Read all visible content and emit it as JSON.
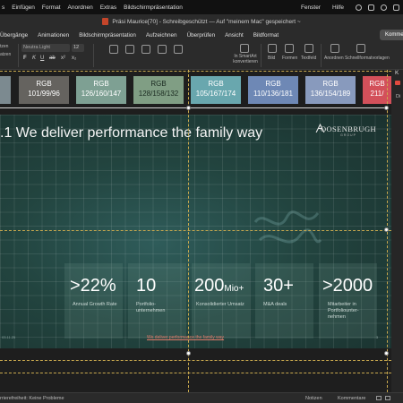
{
  "menubar": {
    "items": [
      "s",
      "Einfügen",
      "Format",
      "Anordnen",
      "Extras",
      "Bildschirmpräsentation"
    ],
    "right_items": [
      "Fenster",
      "Hilfe"
    ]
  },
  "titlebar": {
    "text": "Präsi Maurice[70] - Schreibgeschützt — Auf \"meinem Mac\" gespeichert ~"
  },
  "ribbon": {
    "tabs": [
      "Übergänge",
      "Animationen",
      "Bildschirmpräsentation",
      "Aufzeichnen",
      "Überprüfen",
      "Ansicht",
      "Bildformat"
    ],
    "comment_button": "Komme",
    "font_name": "Neutra Light",
    "font_size": "12",
    "left_partial": "tzen",
    "left_partial2": "atzen",
    "smartart_label": "In SmartArt konvertieren",
    "tools": [
      "Bild",
      "Formen",
      "Textfeld",
      "Anordnen",
      "Schnellformatvorlagen"
    ],
    "bold": "F",
    "italic": "K",
    "underline": "U",
    "strike": "ab",
    "superscript": "x²",
    "subscript": "x₂"
  },
  "swatches": [
    {
      "line1": "",
      "line2": "56",
      "bg": "#7c8a90",
      "fg": "#ffffff"
    },
    {
      "line1": "RGB",
      "line2": "101/99/96",
      "bg": "#65635f",
      "fg": "#ffffff"
    },
    {
      "line1": "RGB",
      "line2": "126/160/147",
      "bg": "#7ea093",
      "fg": "#ffffff"
    },
    {
      "line1": "RGB",
      "line2": "128/158/132",
      "bg": "#809e84",
      "fg": "#1a2a20"
    },
    {
      "line1": "RGB",
      "line2": "105/167/174",
      "bg": "#69a7ae",
      "fg": "#ffffff"
    },
    {
      "line1": "RGB",
      "line2": "110/136/181",
      "bg": "#6e88b5",
      "fg": "#ffffff"
    },
    {
      "line1": "RGB",
      "line2": "136/154/189",
      "bg": "#889abd",
      "fg": "#ffffff"
    },
    {
      "line1": "RGB",
      "line2": "211/",
      "bg": "#d3505a",
      "fg": "#ffffff"
    }
  ],
  "slide": {
    "title": ".1 We deliver performance the family way",
    "logo_name": "OOSENBRUGH",
    "logo_sub": "GROUP",
    "stats": [
      {
        "value": ">22%",
        "unit": "",
        "desc": "Annual Growth Rate"
      },
      {
        "value": "10",
        "unit": "",
        "desc": "Portfolio-unternehmen"
      },
      {
        "value": "200",
        "unit": "Mio+",
        "desc": "Konsolidierter Umsatz"
      },
      {
        "value": "30+",
        "unit": "",
        "desc": "M&A deals"
      },
      {
        "value": ">2000",
        "unit": "",
        "desc": "Mitarbeiter in Portfoliounter-nehmen"
      }
    ],
    "footer_left": "03.11.25",
    "footer_center": "We deliver performance the family way",
    "footer_right": "3"
  },
  "sidepanel": {
    "label_top": "K",
    "label_di": "Di"
  },
  "statusbar": {
    "left": "rrierefreiheit: Keine Probleme",
    "notes": "Notizen",
    "comments": "Kommentare"
  }
}
